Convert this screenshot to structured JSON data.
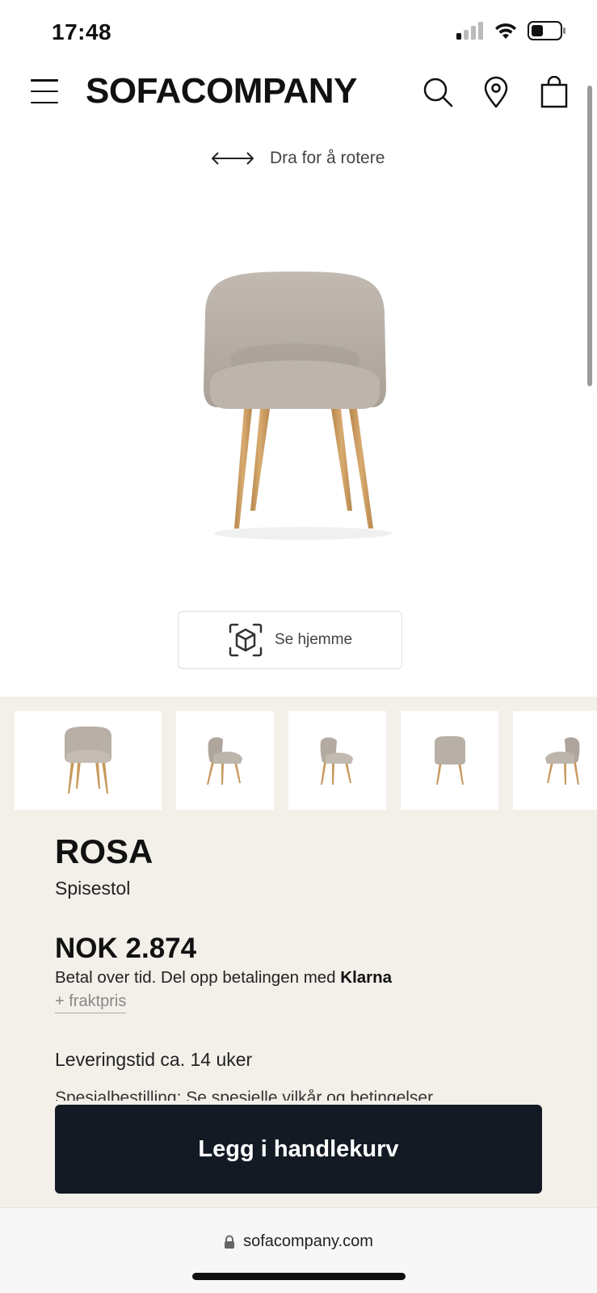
{
  "status_bar": {
    "time": "17:48",
    "icons": [
      "cellular-signal-icon",
      "wifi-icon",
      "battery-icon"
    ]
  },
  "header": {
    "brand": "SOFACOMPANY",
    "icons": [
      "menu-icon",
      "search-icon",
      "location-pin-icon",
      "shopping-bag-icon"
    ]
  },
  "viewer": {
    "rotate_hint": "Dra for å rotere",
    "ar_button_label": "Se hjemme"
  },
  "product": {
    "name": "ROSA",
    "type": "Spisestol",
    "price": "NOK 2.874",
    "klarna_prefix": "Betal over tid. Del opp betalingen med ",
    "klarna_brand": "Klarna",
    "freight_link": "+ fraktpris",
    "delivery": "Leveringstid ca. 14 uker",
    "special_order": "Spesialbestilling: Se spesielle vilkår og betingelser"
  },
  "thumbnails": [
    "front",
    "side-left",
    "side-angle",
    "back",
    "side-right"
  ],
  "cart_button": "Legg i handlekurv",
  "url_bar": {
    "url": "sofacompany.com"
  },
  "colors": {
    "panel_bg": "#f3f0ea",
    "cart_button_bg": "#131a24",
    "fabric": "#b8afa6",
    "wood": "#c89a5f"
  }
}
